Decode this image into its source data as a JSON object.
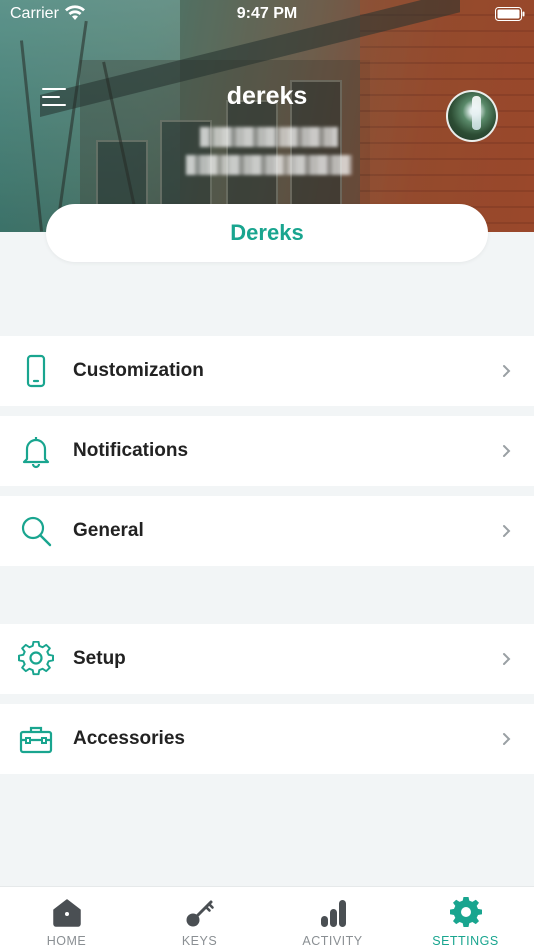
{
  "status_bar": {
    "carrier": "Carrier",
    "time": "9:47 PM"
  },
  "header": {
    "title": "dereks",
    "avatar_icon": "waterfall-photo"
  },
  "profile": {
    "name": "Dereks"
  },
  "settings_groups": [
    [
      {
        "label": "Customization",
        "icon": "phone-icon"
      },
      {
        "label": "Notifications",
        "icon": "bell-icon"
      },
      {
        "label": "General",
        "icon": "search-icon"
      }
    ],
    [
      {
        "label": "Setup",
        "icon": "gear-icon"
      },
      {
        "label": "Accessories",
        "icon": "toolbox-icon"
      }
    ]
  ],
  "tabs": [
    {
      "label": "HOME",
      "icon": "home-icon",
      "active": false
    },
    {
      "label": "KEYS",
      "icon": "key-icon",
      "active": false
    },
    {
      "label": "ACTIVITY",
      "icon": "bar-chart-icon",
      "active": false
    },
    {
      "label": "SETTINGS",
      "icon": "gear-icon",
      "active": true
    }
  ],
  "colors": {
    "accent": "#19a58f",
    "background": "#f2f5f6",
    "inactive_tab": "#8a8f93",
    "icon_dark": "#4a4f53"
  }
}
